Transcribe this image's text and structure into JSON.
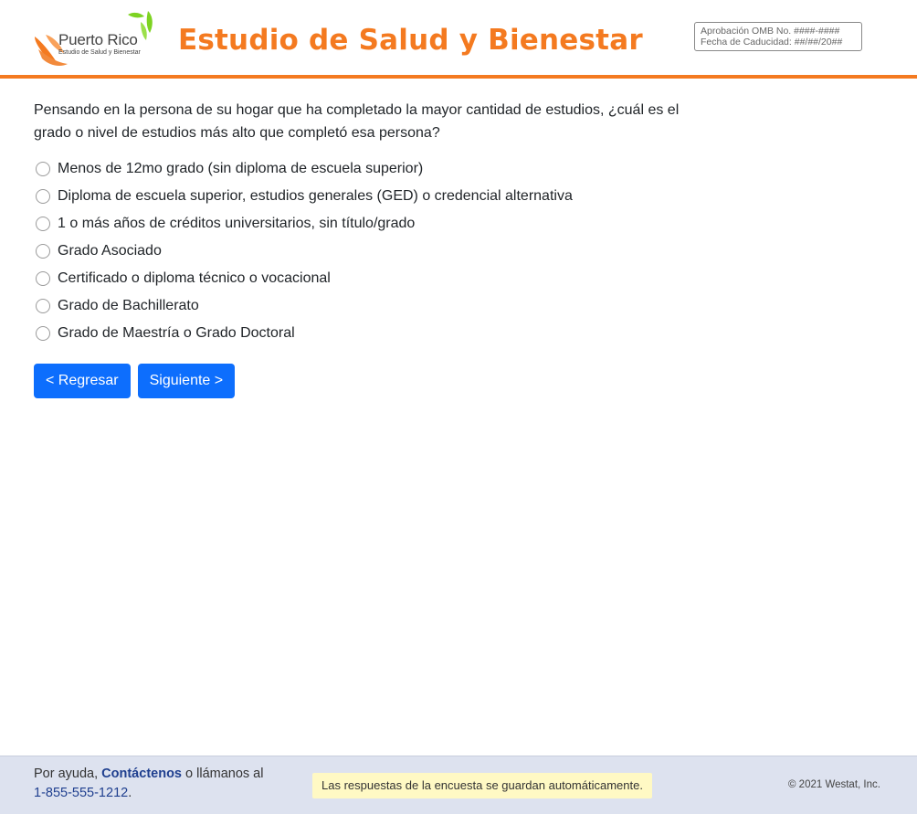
{
  "colors": {
    "accent": "#f47a20",
    "primary": "#0d6efd",
    "logo_leaf": "#7dd321"
  },
  "header": {
    "logo_text": "Puerto Rico",
    "logo_subtitle": "Estudio de Salud y Bienestar",
    "title": "Estudio de Salud y Bienestar",
    "omb_approval": "Aprobación OMB No. ####-####",
    "omb_expiration": "Fecha de Caducidad: ##/##/20##"
  },
  "question": {
    "text": "Pensando en la persona de su hogar que ha completado la mayor cantidad de estudios, ¿cuál es el grado o nivel de estudios más alto que completó esa persona?",
    "options": [
      "Menos de 12mo grado (sin diploma de escuela superior)",
      "Diploma de escuela superior, estudios generales (GED) o credencial alternativa",
      "1 o más años de créditos universitarios, sin título/grado",
      "Grado Asociado",
      "Certificado o diploma técnico o vocacional",
      "Grado de Bachillerato",
      "Grado de Maestría o Grado Doctoral"
    ]
  },
  "buttons": {
    "back": "< Regresar",
    "next": "Siguiente >"
  },
  "footer": {
    "help_prefix": "Por ayuda,",
    "contact_link": "Contáctenos",
    "help_middle": "o llámanos al",
    "phone": "1-855-555-1212",
    "phone_suffix": ".",
    "autosave_notice": "Las respuestas de la encuesta se guardan automáticamente.",
    "copyright": "© 2021 Westat, Inc."
  }
}
